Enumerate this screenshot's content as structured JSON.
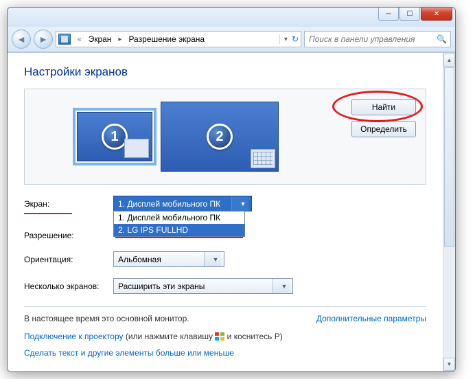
{
  "breadcrumb": {
    "item1": "Экран",
    "item2": "Разрешение экрана"
  },
  "search": {
    "placeholder": "Поиск в панели управления"
  },
  "page": {
    "title": "Настройки экранов"
  },
  "buttons": {
    "find": "Найти",
    "detect": "Определить"
  },
  "monitors": {
    "num1": "1",
    "num2": "2"
  },
  "labels": {
    "screen": "Экран:",
    "resolution": "Разрешение:",
    "orientation": "Ориентация:",
    "multi": "Несколько экранов:"
  },
  "screen_combo": {
    "selected": "1. Дисплей мобильного ПК",
    "options": [
      "1. Дисплей мобильного ПК",
      "2. LG IPS FULLHD"
    ]
  },
  "orientation": {
    "value": "Альбомная"
  },
  "multi": {
    "value": "Расширить эти экраны"
  },
  "footer": {
    "primary": "В настоящее время это основной монитор.",
    "advanced": "Дополнительные параметры",
    "projector_link": "Подключение к проектору",
    "projector_hint_before": " (или нажмите клавишу ",
    "projector_hint_after": " и коснитесь P)",
    "text_size": "Сделать текст и другие элементы больше или меньше"
  }
}
